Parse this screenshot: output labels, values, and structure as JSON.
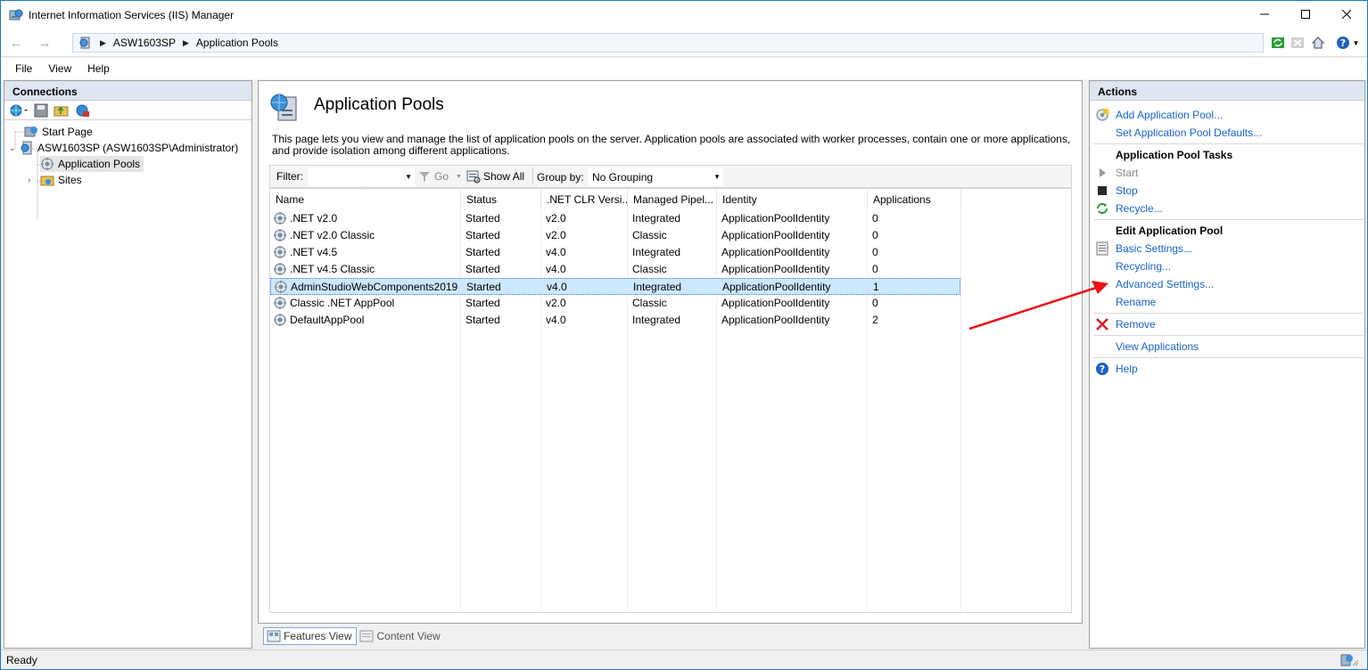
{
  "window": {
    "title": "Internet Information Services (IIS) Manager"
  },
  "address": {
    "segments": [
      "ASW1603SP",
      "Application Pools"
    ]
  },
  "menu": [
    "File",
    "View",
    "Help"
  ],
  "connections": {
    "header": "Connections",
    "tree": {
      "start_page": "Start Page",
      "server": "ASW1603SP (ASW1603SP\\Administrator)",
      "app_pools": "Application Pools",
      "sites": "Sites"
    }
  },
  "main": {
    "title": "Application Pools",
    "description": "This page lets you view and manage the list of application pools on the server. Application pools are associated with worker processes, contain one or more applications, and provide isolation among different applications.",
    "filter": {
      "label": "Filter:",
      "go": "Go",
      "show_all": "Show All",
      "group_by_label": "Group by:",
      "group_by_value": "No Grouping"
    },
    "columns": [
      "Name",
      "Status",
      ".NET CLR Versi...",
      "Managed Pipel...",
      "Identity",
      "Applications"
    ],
    "rows": [
      {
        "name": ".NET v2.0",
        "status": "Started",
        "clr": "v2.0",
        "pipeline": "Integrated",
        "identity": "ApplicationPoolIdentity",
        "apps": "0"
      },
      {
        "name": ".NET v2.0 Classic",
        "status": "Started",
        "clr": "v2.0",
        "pipeline": "Classic",
        "identity": "ApplicationPoolIdentity",
        "apps": "0"
      },
      {
        "name": ".NET v4.5",
        "status": "Started",
        "clr": "v4.0",
        "pipeline": "Integrated",
        "identity": "ApplicationPoolIdentity",
        "apps": "0"
      },
      {
        "name": ".NET v4.5 Classic",
        "status": "Started",
        "clr": "v4.0",
        "pipeline": "Classic",
        "identity": "ApplicationPoolIdentity",
        "apps": "0"
      },
      {
        "name": "AdminStudioWebComponents2019",
        "status": "Started",
        "clr": "v4.0",
        "pipeline": "Integrated",
        "identity": "ApplicationPoolIdentity",
        "apps": "1"
      },
      {
        "name": "Classic .NET AppPool",
        "status": "Started",
        "clr": "v2.0",
        "pipeline": "Classic",
        "identity": "ApplicationPoolIdentity",
        "apps": "0"
      },
      {
        "name": "DefaultAppPool",
        "status": "Started",
        "clr": "v4.0",
        "pipeline": "Integrated",
        "identity": "ApplicationPoolIdentity",
        "apps": "2"
      }
    ],
    "selected_row": "AdminStudioWebComponents2019",
    "view_tabs": {
      "features": "Features View",
      "content": "Content View"
    }
  },
  "actions": {
    "header": "Actions",
    "add_pool": "Add Application Pool...",
    "set_defaults": "Set Application Pool Defaults...",
    "tasks_header": "Application Pool Tasks",
    "start": "Start",
    "stop": "Stop",
    "recycle": "Recycle...",
    "edit_header": "Edit Application Pool",
    "basic_settings": "Basic Settings...",
    "recycling": "Recycling...",
    "advanced_settings": "Advanced Settings...",
    "rename": "Rename",
    "remove": "Remove",
    "view_apps": "View Applications",
    "help": "Help"
  },
  "status": {
    "text": "Ready"
  },
  "colors": {
    "link": "#1a62c7",
    "selection": "#cce8ff",
    "header_bg": "#dde6f1",
    "annotation_arrow": "#e8141a"
  }
}
